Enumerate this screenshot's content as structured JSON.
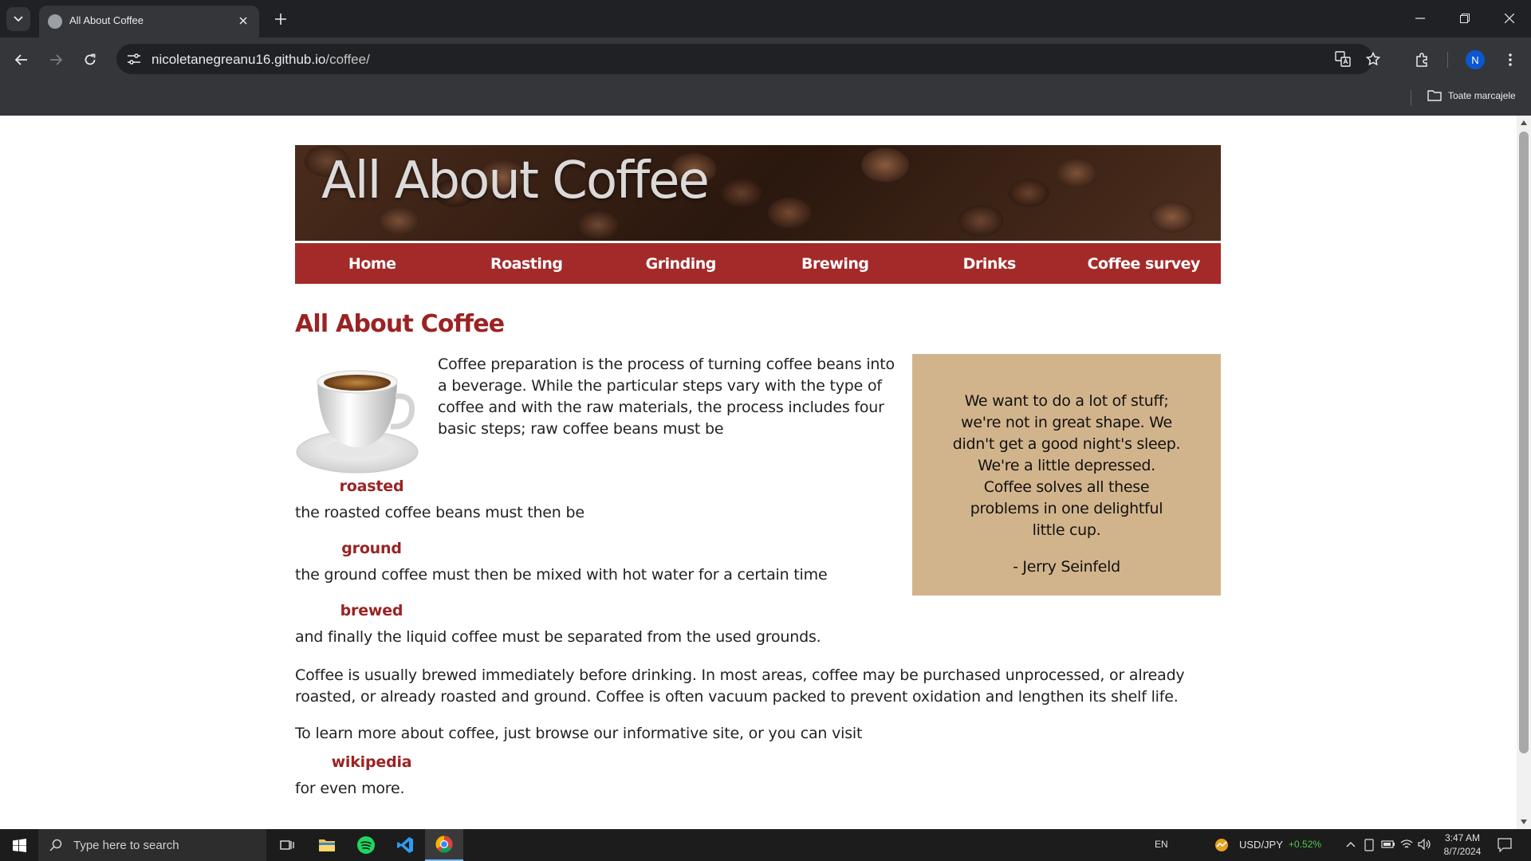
{
  "browser": {
    "tab_title": "All About Coffee",
    "url_host": "nicoletanegreanu16.github.io",
    "url_path": "/coffee/",
    "profile_initial": "N",
    "bookmarks_all_label": "Toate marcajele"
  },
  "site": {
    "banner_title": "All About Coffee",
    "nav": [
      "Home",
      "Roasting",
      "Grinding",
      "Brewing",
      "Drinks",
      "Coffee survey"
    ],
    "heading": "All About Coffee",
    "intro": "Coffee preparation is the process of turning coffee beans into a beverage. While the particular steps vary with the type of coffee and with the raw materials, the process includes four basic steps; raw coffee beans must be",
    "term_roasted": "roasted",
    "line_roasted": "the roasted coffee beans must then be",
    "term_ground": "ground",
    "line_ground": "the ground coffee must then be mixed with hot water for a certain time",
    "term_brewed": "brewed",
    "line_brewed": "and finally the liquid coffee must be separated from the used grounds.",
    "para_usage": "Coffee is usually brewed immediately before drinking. In most areas, coffee may be purchased unprocessed, or already roasted, or already roasted and ground. Coffee is often vacuum packed to prevent oxidation and lengthen its shelf life.",
    "para_learn": "To learn more about coffee, just browse our informative site, or you can visit",
    "link_wikipedia": "wikipedia",
    "line_more": "for even more.",
    "quote": "We want to do a lot of stuff; we're not in great shape. We didn't get a good night's sleep. We're a little depressed. Coffee solves all these problems in one delightful little cup.",
    "quote_author": "- Jerry Seinfeld"
  },
  "taskbar": {
    "search_placeholder": "Type here to search",
    "language": "EN",
    "ticker_symbol": "USD/JPY",
    "ticker_change": "+0.52%",
    "time": "3:47 AM",
    "date": "8/7/2024"
  },
  "colors": {
    "accent_red": "#a42a2a",
    "quote_bg": "#d2b48c",
    "ticker_up": "#4ec94e"
  }
}
